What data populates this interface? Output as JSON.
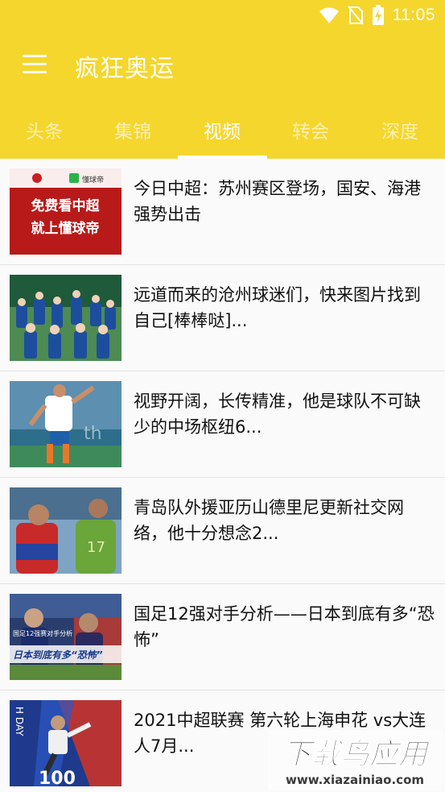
{
  "status_bar": {
    "time": "11:05",
    "icons": [
      "wifi-icon",
      "no-sim-icon",
      "battery-charging-icon"
    ]
  },
  "app_bar": {
    "title": "疯狂奥运",
    "menu_icon": "hamburger-menu-icon"
  },
  "tabs": [
    {
      "label": "头条",
      "active": false
    },
    {
      "label": "集锦",
      "active": false
    },
    {
      "label": "视频",
      "active": true
    },
    {
      "label": "转会",
      "active": false
    },
    {
      "label": "深度",
      "active": false
    }
  ],
  "items": [
    {
      "title": "今日中超：苏州赛区登场，国安、海港强势出击",
      "thumb_line1": "免费看中超",
      "thumb_line2": "就上懂球帝",
      "thumb_logo_text": "懂球帝"
    },
    {
      "title": "远道而来的沧州球迷们，快来图片找到自己[棒棒哒]..."
    },
    {
      "title": "视野开阔，长传精准，他是球队不可缺少的中场枢纽6..."
    },
    {
      "title": "青岛队外援亚历山德里尼更新社交网络，他十分想念2..."
    },
    {
      "title": "国足12强对手分析——日本到底有多“恐怖”",
      "thumb_caption": "日本到底有多“恐怖”",
      "thumb_small": "国足12强赛对手分析"
    },
    {
      "title": "2021中超联赛 第六轮上海申花 vs大连人7月...",
      "thumb_number": "100",
      "thumb_vertical": "H DAY"
    }
  ],
  "watermark": {
    "line1": "下载鸟应用",
    "line2": "www.xiazainiao.com"
  },
  "colors": {
    "brand": "#f5d62d",
    "tab_inactive": "#fbefb0",
    "tab_active": "#ffffff"
  }
}
